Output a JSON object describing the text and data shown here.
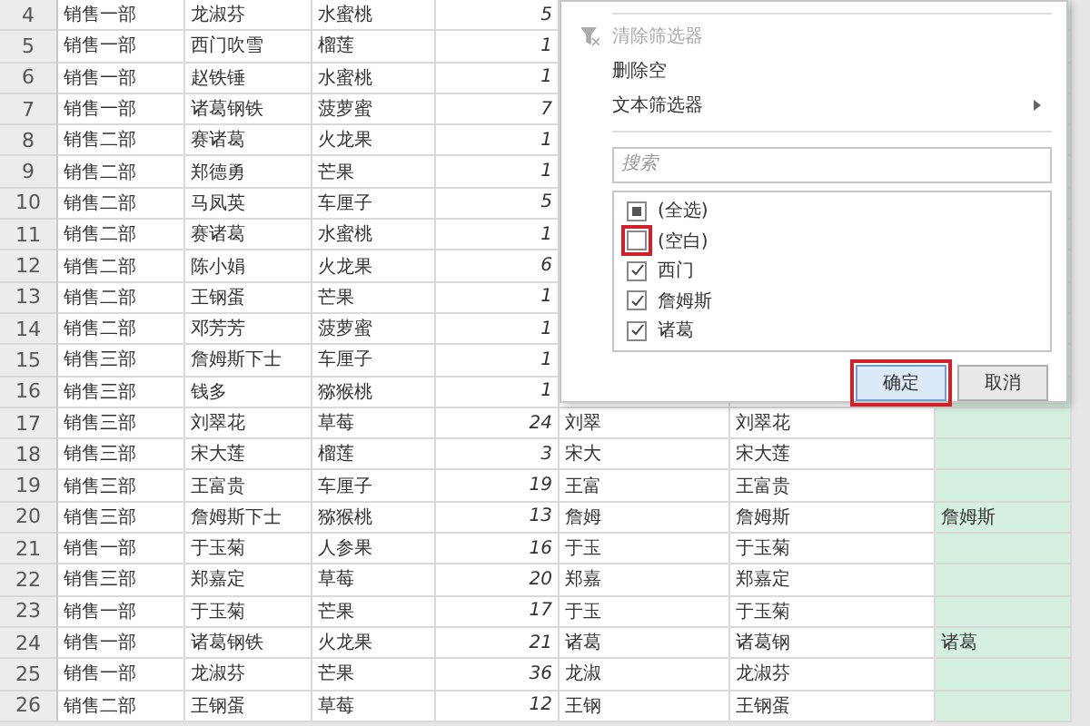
{
  "rows": [
    {
      "num": "4",
      "cells": [
        "销售一部",
        "龙淑芬",
        "水蜜桃",
        "5",
        "",
        "",
        ""
      ]
    },
    {
      "num": "5",
      "cells": [
        "销售一部",
        "西门吹雪",
        "榴莲",
        "1",
        "",
        "",
        ""
      ]
    },
    {
      "num": "6",
      "cells": [
        "销售一部",
        "赵铁锤",
        "水蜜桃",
        "1",
        "",
        "",
        ""
      ]
    },
    {
      "num": "7",
      "cells": [
        "销售一部",
        "诸葛钢铁",
        "菠萝蜜",
        "7",
        "",
        "",
        ""
      ]
    },
    {
      "num": "8",
      "cells": [
        "销售二部",
        "赛诸葛",
        "火龙果",
        "1",
        "",
        "",
        ""
      ]
    },
    {
      "num": "9",
      "cells": [
        "销售二部",
        "郑德勇",
        "芒果",
        "1",
        "",
        "",
        ""
      ]
    },
    {
      "num": "10",
      "cells": [
        "销售二部",
        "马凤英",
        "车厘子",
        "5",
        "",
        "",
        ""
      ]
    },
    {
      "num": "11",
      "cells": [
        "销售二部",
        "赛诸葛",
        "水蜜桃",
        "1",
        "",
        "",
        ""
      ]
    },
    {
      "num": "12",
      "cells": [
        "销售二部",
        "陈小娟",
        "火龙果",
        "6",
        "",
        "",
        ""
      ]
    },
    {
      "num": "13",
      "cells": [
        "销售二部",
        "王钢蛋",
        "芒果",
        "1",
        "",
        "",
        ""
      ]
    },
    {
      "num": "14",
      "cells": [
        "销售二部",
        "邓芳芳",
        "菠萝蜜",
        "1",
        "",
        "",
        ""
      ]
    },
    {
      "num": "15",
      "cells": [
        "销售三部",
        "詹姆斯下士",
        "车厘子",
        "1",
        "",
        "",
        ""
      ]
    },
    {
      "num": "16",
      "cells": [
        "销售三部",
        "钱多",
        "猕猴桃",
        "1",
        "",
        "",
        ""
      ]
    },
    {
      "num": "17",
      "cells": [
        "销售三部",
        "刘翠花",
        "草莓",
        "24",
        "刘翠",
        "刘翠花",
        ""
      ]
    },
    {
      "num": "18",
      "cells": [
        "销售三部",
        "宋大莲",
        "榴莲",
        "3",
        "宋大",
        "宋大莲",
        ""
      ]
    },
    {
      "num": "19",
      "cells": [
        "销售三部",
        "王富贵",
        "车厘子",
        "19",
        "王富",
        "王富贵",
        ""
      ]
    },
    {
      "num": "20",
      "cells": [
        "销售三部",
        "詹姆斯下士",
        "猕猴桃",
        "13",
        "詹姆",
        "詹姆斯",
        "詹姆斯"
      ]
    },
    {
      "num": "21",
      "cells": [
        "销售一部",
        "于玉菊",
        "人参果",
        "16",
        "于玉",
        "于玉菊",
        ""
      ]
    },
    {
      "num": "22",
      "cells": [
        "销售三部",
        "郑嘉定",
        "草莓",
        "20",
        "郑嘉",
        "郑嘉定",
        ""
      ]
    },
    {
      "num": "23",
      "cells": [
        "销售一部",
        "于玉菊",
        "芒果",
        "17",
        "于玉",
        "于玉菊",
        ""
      ]
    },
    {
      "num": "24",
      "cells": [
        "销售一部",
        "诸葛钢铁",
        "火龙果",
        "21",
        "诸葛",
        "诸葛钢",
        "诸葛"
      ]
    },
    {
      "num": "25",
      "cells": [
        "销售一部",
        "龙淑芬",
        "芒果",
        "36",
        "龙淑",
        "龙淑芬",
        ""
      ]
    },
    {
      "num": "26",
      "cells": [
        "销售二部",
        "王钢蛋",
        "草莓",
        "12",
        "王钢",
        "王钢蛋",
        ""
      ]
    }
  ],
  "filter_menu": {
    "menu_items": [
      {
        "label": "清除筛选器",
        "disabled": true,
        "submenu": false
      },
      {
        "label": "删除空",
        "disabled": false,
        "submenu": false
      },
      {
        "label": "文本筛选器",
        "disabled": false,
        "submenu": true
      }
    ],
    "search": {
      "placeholder": "搜索"
    },
    "options": [
      {
        "label": "(全选)",
        "checked": false,
        "indeterminate": true,
        "highlighted": false
      },
      {
        "label": "(空白)",
        "checked": false,
        "indeterminate": false,
        "highlighted": true
      },
      {
        "label": "西门",
        "checked": true,
        "indeterminate": false,
        "highlighted": false
      },
      {
        "label": "詹姆斯",
        "checked": true,
        "indeterminate": false,
        "highlighted": false
      },
      {
        "label": "诸葛",
        "checked": true,
        "indeterminate": false,
        "highlighted": false
      }
    ],
    "buttons": [
      {
        "label": "确定",
        "highlighted": true
      },
      {
        "label": "取消",
        "highlighted": false
      }
    ]
  }
}
